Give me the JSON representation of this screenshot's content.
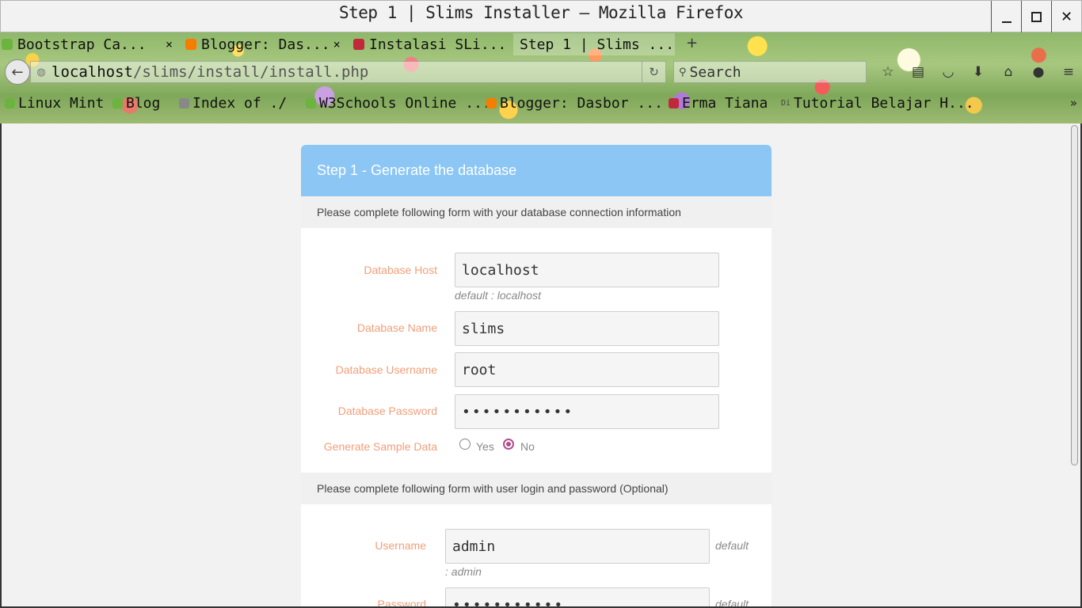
{
  "window": {
    "title": "Step 1 | Slims Installer — Mozilla Firefox",
    "minimize_label": "_",
    "maximize_label": "□",
    "close_label": "✕"
  },
  "tabs": [
    {
      "label": "Bootstrap Ca...",
      "favicon": "linux-mint-icon"
    },
    {
      "label": "Blogger: Das...",
      "favicon": "blogger-icon"
    },
    {
      "label": "Instalasi SLi...",
      "favicon": "slims-icon"
    },
    {
      "label": "Step 1 | Slims ...",
      "favicon": "none",
      "active": true
    }
  ],
  "tab_close_glyph": "×",
  "new_tab_glyph": "+",
  "nav": {
    "back_glyph": "←",
    "url_host": "localhost",
    "url_path": "/slims/install/install.php",
    "reload_glyph": "↻",
    "search_placeholder": "Search"
  },
  "toolbar_icons": [
    "bookmark-star-icon",
    "reading-list-icon",
    "pocket-icon",
    "download-icon",
    "home-icon",
    "chat-icon",
    "menu-icon"
  ],
  "bookmarks": [
    {
      "label": "Linux Mint",
      "favicon": "linux-mint-icon"
    },
    {
      "label": "Blog",
      "favicon": "linux-mint-icon"
    },
    {
      "label": "Index of ./",
      "favicon": "globe-icon"
    },
    {
      "label": "W3Schools Online ...",
      "favicon": "linux-mint-icon"
    },
    {
      "label": "Blogger: Dasbor ...",
      "favicon": "blogger-icon"
    },
    {
      "label": "Erma Tiana",
      "favicon": "slims-icon"
    },
    {
      "label": "Tutorial Belajar H...",
      "favicon": "di-icon"
    }
  ],
  "bookmarks_more": "»",
  "form": {
    "heading": "Step 1 - Generate the database",
    "db_section": "Please complete following form with your database connection information",
    "db_host_label": "Database Host",
    "db_host_value": "localhost",
    "db_host_hint": "default : localhost",
    "db_name_label": "Database Name",
    "db_name_value": "slims",
    "db_user_label": "Database Username",
    "db_user_value": "root",
    "db_pass_label": "Database Password",
    "db_pass_value": "•••••••••••",
    "sample_label": "Generate Sample Data",
    "sample_yes": "Yes",
    "sample_no": "No",
    "sample_selected": "No",
    "user_section": "Please complete following form with user login and password (Optional)",
    "username_label": "Username",
    "username_value": "admin",
    "username_hint_a": "default",
    "username_hint_b": ": admin",
    "password_label": "Password",
    "password_value": "•••••••••••",
    "password_hint": "default"
  },
  "colors": {
    "panel_header": "#8cc6f5",
    "label_color": "#f19f7a",
    "radio_checked": "#b04d8a"
  }
}
